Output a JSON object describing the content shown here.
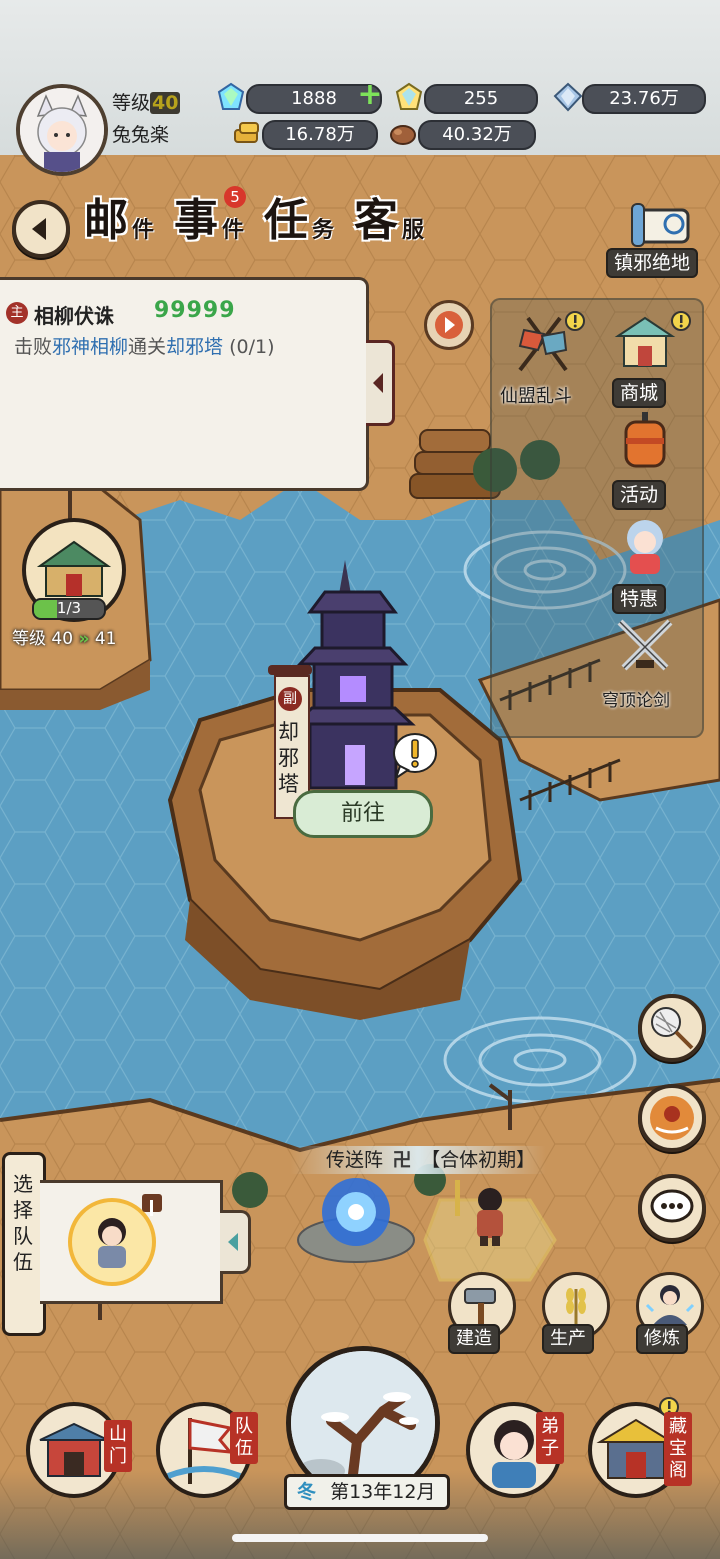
{
  "player": {
    "level_label": "等级",
    "level_value": "40",
    "name": "兔兔楽"
  },
  "currency": {
    "jade": "1888",
    "jade_plus": "+",
    "crystal": "255",
    "spirit_stone": "23.76万",
    "gold": "16.78万",
    "wood": "40.32万"
  },
  "tabs": {
    "mail_main": "邮",
    "mail_sub": "件",
    "event_main": "事",
    "event_sub": "件",
    "event_badge": "5",
    "task_main": "任",
    "task_sub": "务",
    "service_main": "客",
    "service_sub": "服"
  },
  "quest": {
    "type_badge": "主",
    "title": "相柳伏诛",
    "stars": "99999",
    "desc_prefix": "击败",
    "desc_target1": "邪神相柳",
    "desc_mid": "通关",
    "desc_target2": "却邪塔",
    "desc_progress": "(0/1)"
  },
  "side_menu": {
    "zhenxie": "镇邪绝地",
    "xianmeng": "仙盟乱斗",
    "shop": "商城",
    "activity": "活动",
    "special": "特惠",
    "qiongding": "穹顶论剑"
  },
  "building": {
    "progress": "1/3",
    "progress_fraction": 0.33,
    "level_label": "等级",
    "level_from": "40",
    "level_arrow": "»",
    "level_to": "41"
  },
  "tower": {
    "badge": "副",
    "name": "却邪塔",
    "go_button": "前往"
  },
  "portal": {
    "label": "传送阵",
    "realm": "【合体初期】"
  },
  "team": {
    "select_label": "选择队伍"
  },
  "actions": {
    "build": "建造",
    "produce": "生产",
    "cultivate": "修炼"
  },
  "bottom_nav": {
    "shanmen": "山门",
    "duiwu": "队伍",
    "dizi": "弟子",
    "cangbaoge": "藏宝阁",
    "season": "冬",
    "date": "第13年12月"
  },
  "colors": {
    "accent_blue": "#2f6fb0",
    "level_yellow": "#f3e04a",
    "water": "#5b9fc4",
    "land": "#c7935a"
  }
}
